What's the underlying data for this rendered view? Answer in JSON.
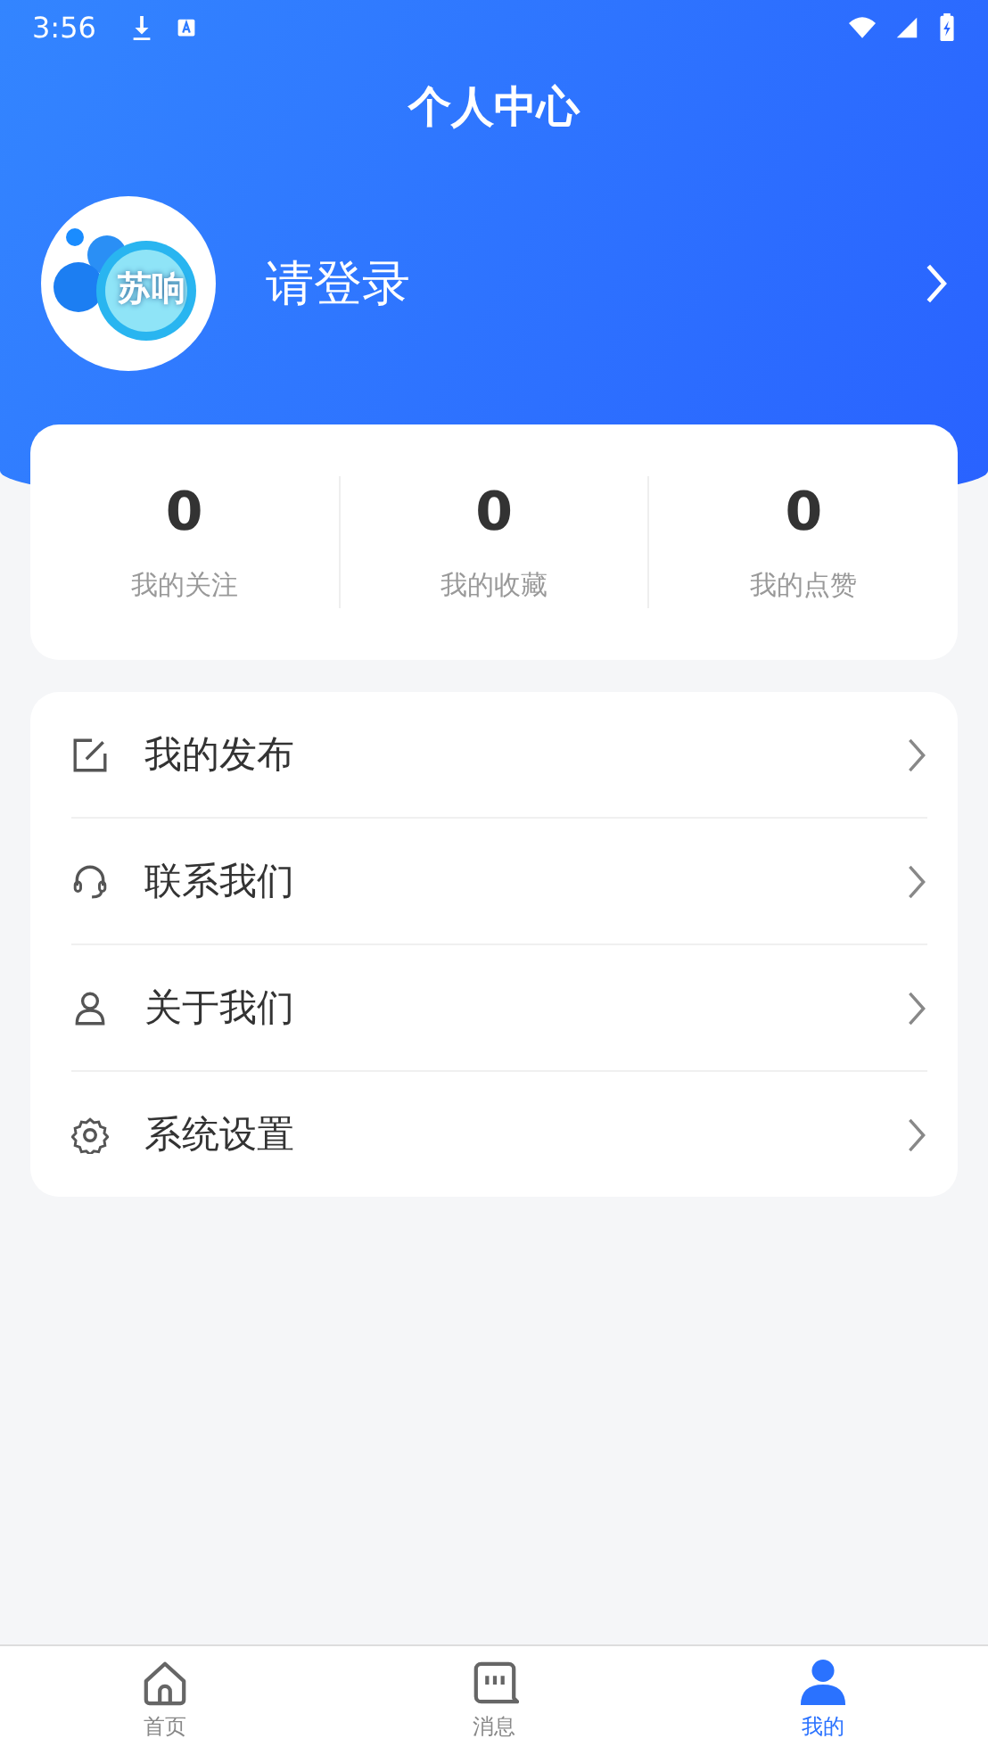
{
  "status_bar": {
    "time": "3:56"
  },
  "header": {
    "title": "个人中心"
  },
  "profile": {
    "logo_text": "苏响",
    "login_label": "请登录"
  },
  "stats": [
    {
      "value": "0",
      "label": "我的关注"
    },
    {
      "value": "0",
      "label": "我的收藏"
    },
    {
      "value": "0",
      "label": "我的点赞"
    }
  ],
  "menu": [
    {
      "label": "我的发布"
    },
    {
      "label": "联系我们"
    },
    {
      "label": "关于我们"
    },
    {
      "label": "系统设置"
    }
  ],
  "tab_bar": [
    {
      "label": "首页",
      "selected": false
    },
    {
      "label": "消息",
      "selected": false
    },
    {
      "label": "我的",
      "selected": true
    }
  ]
}
